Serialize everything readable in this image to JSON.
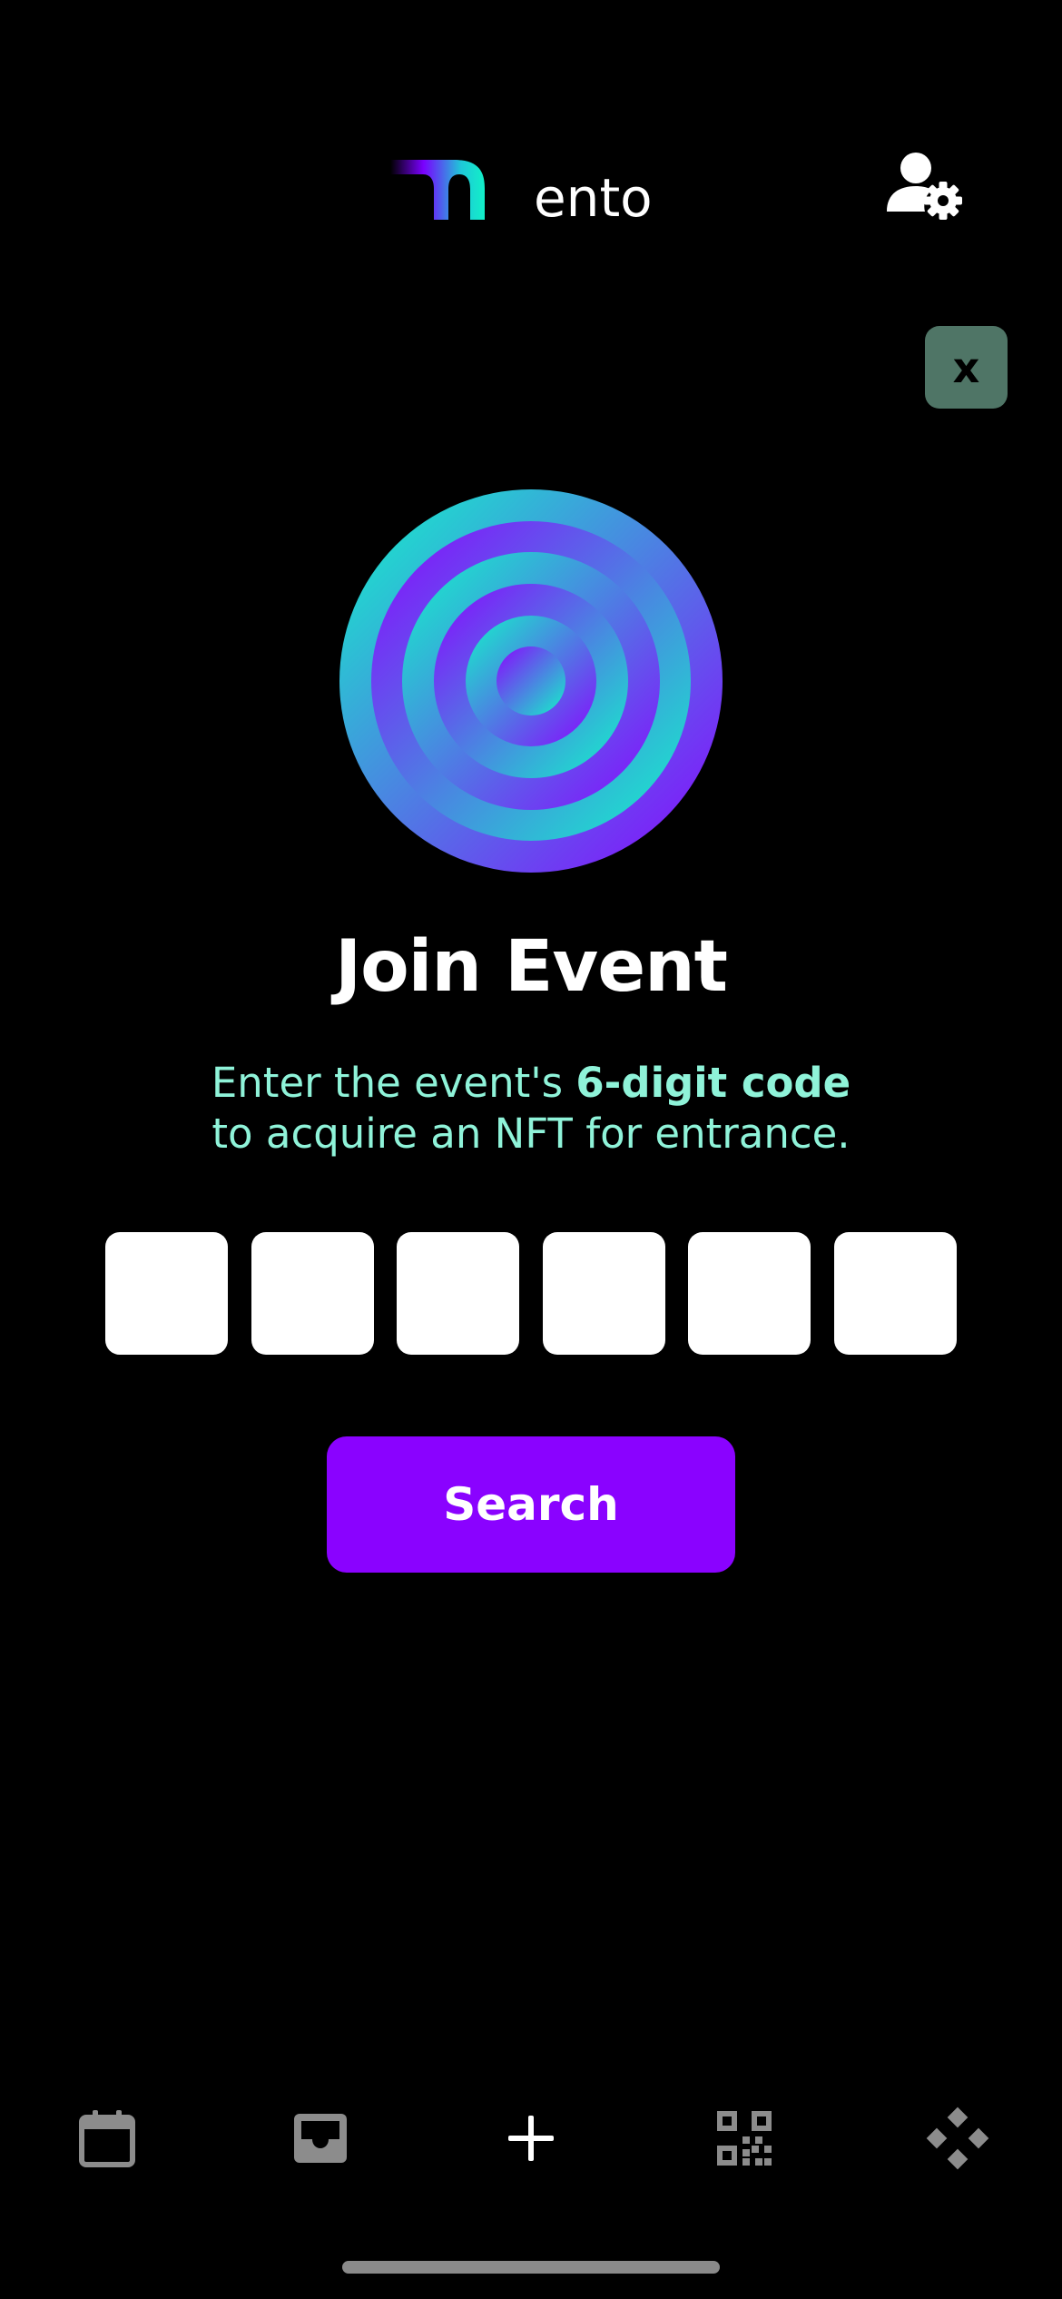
{
  "header": {
    "logo_text": "ento",
    "account_icon": "user-settings-icon"
  },
  "close_button": {
    "label": "x"
  },
  "main": {
    "title": "Join Event",
    "subtitle_part1": "Enter the event's ",
    "subtitle_bold": "6-digit code",
    "subtitle_line2": "to acquire an NFT for entrance.",
    "code_digits": [
      "",
      "",
      "",
      "",
      "",
      ""
    ],
    "search_label": "Search"
  },
  "tabbar": {
    "items": [
      {
        "icon": "calendar-icon"
      },
      {
        "icon": "inbox-icon"
      },
      {
        "icon": "plus-icon"
      },
      {
        "icon": "qr-code-icon"
      },
      {
        "icon": "diamond-grid-icon"
      }
    ]
  },
  "colors": {
    "background": "#000000",
    "accent_purple": "#8a02ff",
    "accent_mint": "#8ff3d9",
    "close_bg": "#4f7566"
  }
}
